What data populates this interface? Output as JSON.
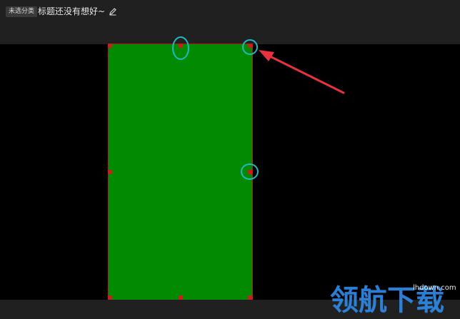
{
  "header": {
    "category_tag": "未选分类",
    "title": "标题还没有想好~",
    "edit_icon": "pencil-icon"
  },
  "canvas": {
    "shape_color": "#028a02",
    "background_color": "#000000",
    "handle_color": "#c81e1e",
    "highlight_ring_color": "#22b8c4",
    "arrow_color": "#e8323c"
  },
  "watermark": {
    "logo": "领航下载",
    "site": "lhdown.com"
  }
}
